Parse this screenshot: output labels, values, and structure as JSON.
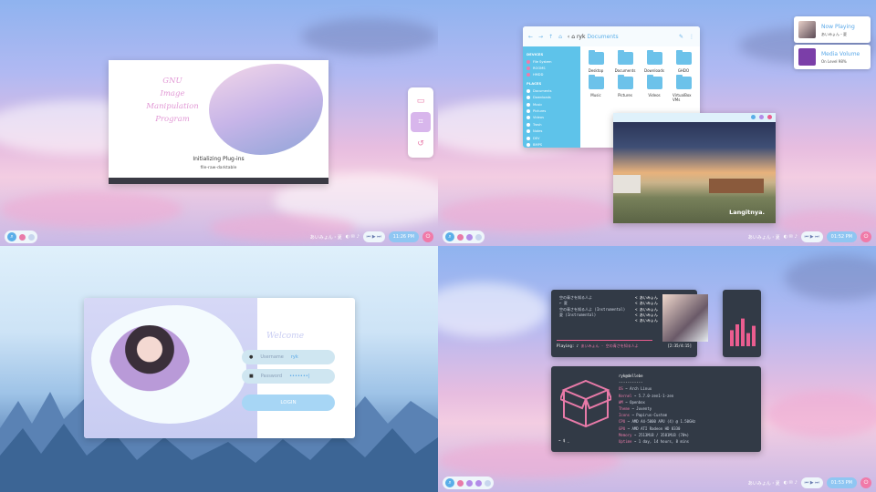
{
  "panel_tl": {
    "splash": {
      "title_lines": [
        "GNU",
        "Image",
        "Manipulation",
        "Program"
      ],
      "status": "Initializing Plug-ins",
      "file": "file-raw-darktable"
    },
    "tools": [
      "monitor-icon",
      "crop-icon",
      "rotate-icon"
    ],
    "taskbar": {
      "user": "あいみょん・夏",
      "clock": "11:26 PM"
    }
  },
  "panel_tr": {
    "file_manager": {
      "breadcrumb": "ryk",
      "location": "Documents",
      "devices_header": "DEVICES",
      "devices": [
        "File System",
        "ROOMS",
        "HMDD"
      ],
      "places_header": "PLACES",
      "places": [
        "Documents",
        "Downloads",
        "Music",
        "Pictures",
        "Videos",
        "Trash",
        "Notes",
        "DEV",
        "BMPS"
      ],
      "files": [
        {
          "name": "Desktop",
          "icon": "folder-icon"
        },
        {
          "name": "Documents",
          "icon": "folder-icon"
        },
        {
          "name": "Downloads",
          "icon": "download-folder-icon"
        },
        {
          "name": "GHDO",
          "icon": "folder-icon"
        },
        {
          "name": "Music",
          "icon": "music-folder-icon"
        },
        {
          "name": "Pictures",
          "icon": "pictures-folder-icon"
        },
        {
          "name": "Videos",
          "icon": "videos-folder-icon"
        },
        {
          "name": "VirtualBox VMs",
          "icon": "folder-icon"
        }
      ]
    },
    "image_viewer": {
      "caption": "Langitnya."
    },
    "notifications": [
      {
        "title": "Now Playing",
        "sub": "あいみょん・夏",
        "icon": "album-art"
      },
      {
        "title": "Media Volume",
        "sub": "On Level 98%",
        "icon": "volume-icon"
      }
    ],
    "taskbar": {
      "user": "あいみょん・夏",
      "clock": "01:52 PM"
    }
  },
  "panel_bl": {
    "login": {
      "welcome": "Welcome",
      "username_label": "Username",
      "username_value": "ryk",
      "password_label": "Password",
      "password_value": "•••••••|",
      "button": "LOGIN"
    }
  },
  "panel_br": {
    "player": {
      "lyrics": [
        [
          "空の青さを知る人よ",
          "< あいみょん"
        ],
        [
          "← 夏",
          "< あいみょん"
        ],
        [
          "空の青さを知る人よ (Instrumental)",
          "< あいみょん"
        ],
        [
          "夏 (Instrumental)",
          "< あいみょん"
        ],
        [
          "",
          "< あいみょん"
        ]
      ],
      "playing_label": "Playing: ♪",
      "track": "あいみょん - 空の青さを知る人よ",
      "time": "[2:35/4:15]",
      "bars": [
        0.55,
        0.75,
        0.95,
        0.45,
        0.7
      ]
    },
    "fetch": {
      "user": "ryk@dellebe",
      "lines": [
        [
          "OS",
          "Arch Linux"
        ],
        [
          "Kernel",
          "5.7.0-zen1-1-zen"
        ],
        [
          "WM",
          "Openbox"
        ],
        [
          "Theme",
          "Juventy"
        ],
        [
          "Icons",
          "Papirus-Custom"
        ],
        [
          "CPU",
          "AMD A4-5000 APU (4) @ 1.50GHz"
        ],
        [
          "GPU",
          "AMD ATI Radeon HD 8330"
        ],
        [
          "Memory",
          "2513MiB / 3581MiB (70%)"
        ],
        [
          "Uptime",
          "1 day, 14 hours, 8 mins"
        ]
      ],
      "prompt": "~ $ _"
    },
    "taskbar": {
      "user": "あいみょん・夏",
      "clock": "01:53 PM"
    }
  },
  "colors": {
    "accent_blue": "#5aaee8",
    "accent_pink": "#ea5d8f",
    "terminal_bg": "#323a46"
  }
}
